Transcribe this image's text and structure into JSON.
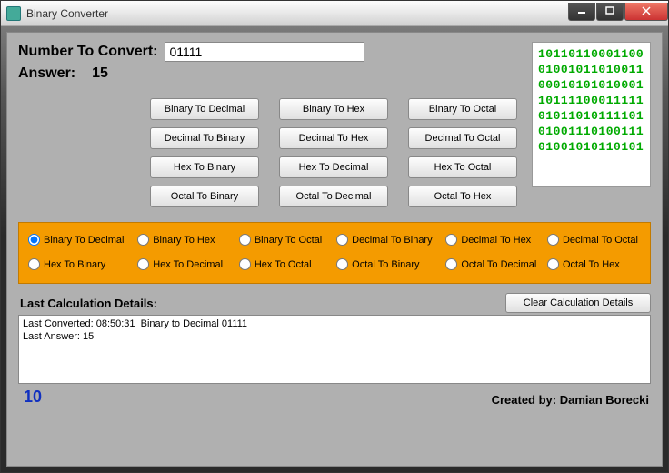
{
  "window": {
    "title": "Binary Converter"
  },
  "input": {
    "label": "Number To Convert:",
    "value": "01111"
  },
  "answer": {
    "label": "Answer:",
    "value": "15"
  },
  "buttons": {
    "r0": [
      "Binary To Decimal",
      "Binary To Hex",
      "Binary To Octal"
    ],
    "r1": [
      "Decimal To Binary",
      "Decimal To Hex",
      "Decimal To Octal"
    ],
    "r2": [
      "Hex To Binary",
      "Hex To Decimal",
      "Hex To Octal"
    ],
    "r3": [
      "Octal To Binary",
      "Octal To Decimal",
      "Octal To Hex"
    ]
  },
  "binart": "10110110001100\n01001011010011\n00010101010001\n10111100011111\n01011010111101\n01001110100111\n01001010110101",
  "radios": {
    "row0": [
      {
        "label": "Binary To Decimal",
        "checked": true
      },
      {
        "label": "Binary To Hex",
        "checked": false
      },
      {
        "label": "Binary To Octal",
        "checked": false
      },
      {
        "label": "Decimal To Binary",
        "checked": false
      },
      {
        "label": "Decimal To Hex",
        "checked": false
      },
      {
        "label": "Decimal To Octal",
        "checked": false
      }
    ],
    "row1": [
      {
        "label": "Hex To Binary",
        "checked": false
      },
      {
        "label": "Hex To Decimal",
        "checked": false
      },
      {
        "label": "Hex To Octal",
        "checked": false
      },
      {
        "label": "Octal To Binary",
        "checked": false
      },
      {
        "label": "Octal To Decimal",
        "checked": false
      },
      {
        "label": "Octal To Hex",
        "checked": false
      }
    ]
  },
  "details": {
    "header": "Last Calculation Details:",
    "clear": "Clear Calculation Details",
    "text": "Last Converted: 08:50:31  Binary to Decimal 01111\nLast Answer: 15"
  },
  "footer": {
    "num": "10",
    "credit": "Created by: Damian Borecki"
  }
}
